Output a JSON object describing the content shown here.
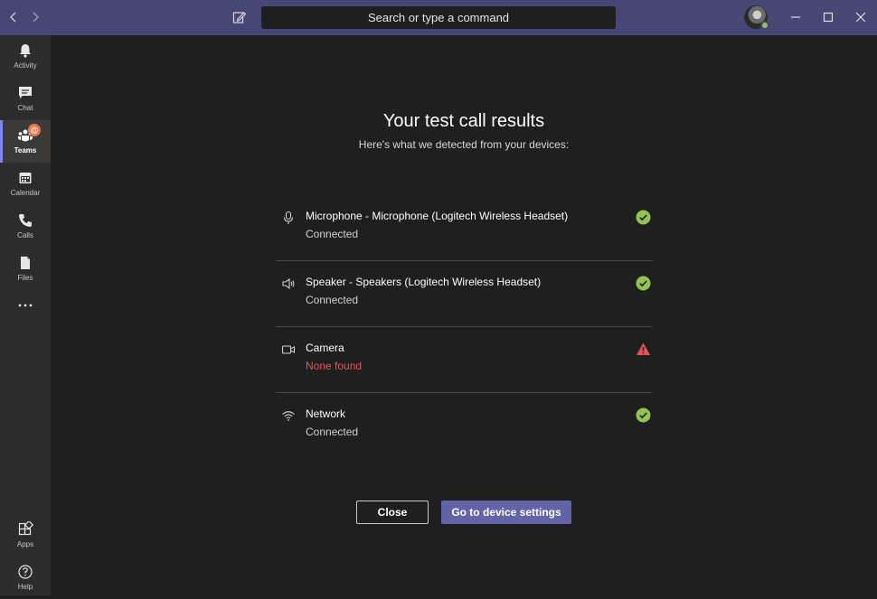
{
  "titlebar": {
    "search_placeholder": "Search or type a command",
    "accent": "#464775"
  },
  "rail": {
    "items": [
      {
        "label": "Activity",
        "icon": "bell-icon"
      },
      {
        "label": "Chat",
        "icon": "chat-icon"
      },
      {
        "label": "Teams",
        "icon": "teams-icon",
        "active": true,
        "badge": "@"
      },
      {
        "label": "Calendar",
        "icon": "calendar-icon"
      },
      {
        "label": "Calls",
        "icon": "phone-icon"
      },
      {
        "label": "Files",
        "icon": "file-icon"
      },
      {
        "label": "...",
        "icon": "more-icon"
      }
    ],
    "bottom": [
      {
        "label": "Apps",
        "icon": "apps-icon"
      },
      {
        "label": "Help",
        "icon": "help-icon"
      }
    ]
  },
  "main": {
    "title": "Your test call results",
    "subtitle": "Here's what we detected from your devices:",
    "devices": [
      {
        "name": "Microphone - Microphone (Logitech Wireless Headset)",
        "status": "Connected",
        "icon": "microphone-icon",
        "result": "ok"
      },
      {
        "name": "Speaker - Speakers (Logitech Wireless Headset)",
        "status": "Connected",
        "icon": "speaker-icon",
        "result": "ok"
      },
      {
        "name": "Camera",
        "status": "None found",
        "icon": "camera-icon",
        "result": "warning"
      },
      {
        "name": "Network",
        "status": "Connected",
        "icon": "wifi-icon",
        "result": "ok"
      }
    ],
    "close_label": "Close",
    "settings_label": "Go to device settings"
  },
  "colors": {
    "success": "#92c353",
    "error": "#e3555a",
    "primary": "#6264a7"
  }
}
